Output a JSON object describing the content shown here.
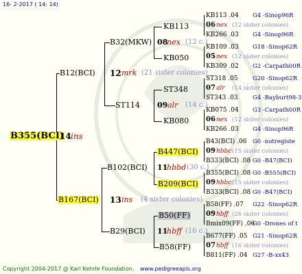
{
  "header": {
    "date": "16-  2-2017 ( 14: 14)"
  },
  "root": {
    "id": "B355(BCI)",
    "num": "14",
    "race": "ins"
  },
  "gen1": {
    "top": {
      "id": "B12(BCI)",
      "num": "12",
      "race": "mrk",
      "sisters": "(21 sister colonies)"
    },
    "bottom": {
      "id": "B167(BCI)",
      "num": "13",
      "race": "ins",
      "sisters": "(4 sister colonies)"
    }
  },
  "gen2": {
    "a": {
      "id": "B32(MKW)",
      "num": "08",
      "race": "nex",
      "sisters": "(12 c.)"
    },
    "b": {
      "id": "ST114",
      "num": "09",
      "race": "alr",
      "sisters": "(14 c.)"
    },
    "c": {
      "id": "B102(BCI)",
      "num": "11",
      "race": "hbbd",
      "sisters": "(30 c.)"
    },
    "d": {
      "id": "B29(BCI)",
      "num": "11",
      "race": "hbff",
      "sisters": "(16 c.)"
    }
  },
  "gen3": [
    "KB113",
    "KB050",
    "ST348",
    "KB080",
    "B447(BCI)",
    "B209(BCI)",
    "B50(FF)",
    "B58(FF)"
  ],
  "gen4": [
    {
      "top": "KB113 .04",
      "top_line": "G4 -Sinop96R",
      "num": "06",
      "race": "nex",
      "sis": "(12 sister colonies)",
      "bot": "KB266 .03",
      "bot_line": "G4 -Sinop96R"
    },
    {
      "top": "KB109 .03",
      "top_line": "G18 -Sinop62R",
      "num": "05",
      "race": "nex",
      "sis": "(12 sister colonies)",
      "bot": "KB309 .02",
      "bot_line": "G2 -Carpath00R"
    },
    {
      "top": "ST318 .05",
      "top_line": "G20 -Sinop62R",
      "num": "07",
      "race": "alr",
      "sis": "(14 sister colonies)",
      "bot": "ST343 .03",
      "bot_line": "G4 -Bayburt98-3"
    },
    {
      "top": "KB075 .04",
      "top_line": "G3 -Carpath00R",
      "num": "06",
      "race": "nex",
      "sis": "(12 sister colonies)",
      "bot": "KB266 .03",
      "bot_line": "G4 -Sinop96R"
    },
    {
      "top": "B43(BCI) .06",
      "top_line": "G0 -notregiste",
      "num": "09",
      "race": "hbbc",
      "sis": "(15 sister colonies)",
      "bot": "B333(BCI) .08",
      "bot_line": "G0 -B47(BCI)"
    },
    {
      "top": "B355(BCI) .08",
      "top_line": "G0 -B555(BCI)",
      "num": "09",
      "race": "hbbc",
      "sis": "(15 sister colonies)",
      "bot": "B333(BCI) .08",
      "bot_line": "G0 -B47(BCI)"
    },
    {
      "top": "B58(FF) .07",
      "top_line": "G22 -Sinop62R",
      "num": "09",
      "race": "hbff",
      "sis": "(26 sister colonies)",
      "bot": "Bmix09(FF) .06",
      "bot_line": "G0 -Drones of t"
    },
    {
      "top": "B677(FF) .05",
      "top_line": "G21 -Sinop62R",
      "num": "07",
      "race": "hbff",
      "sis": "(16 sister colonies)",
      "bot": "B811(FF) .04",
      "bot_line": "G27 -B-xx43"
    }
  ],
  "footer": {
    "copyright": "Copyright 2004-2017 @ Karl Kehrle Foundation.",
    "site": "www.pedigreeapis.org"
  },
  "colors": {
    "highlight": "#ffff33",
    "race_red": "#cc0000",
    "line_blue": "#0000aa",
    "footer_green": "#008000"
  }
}
